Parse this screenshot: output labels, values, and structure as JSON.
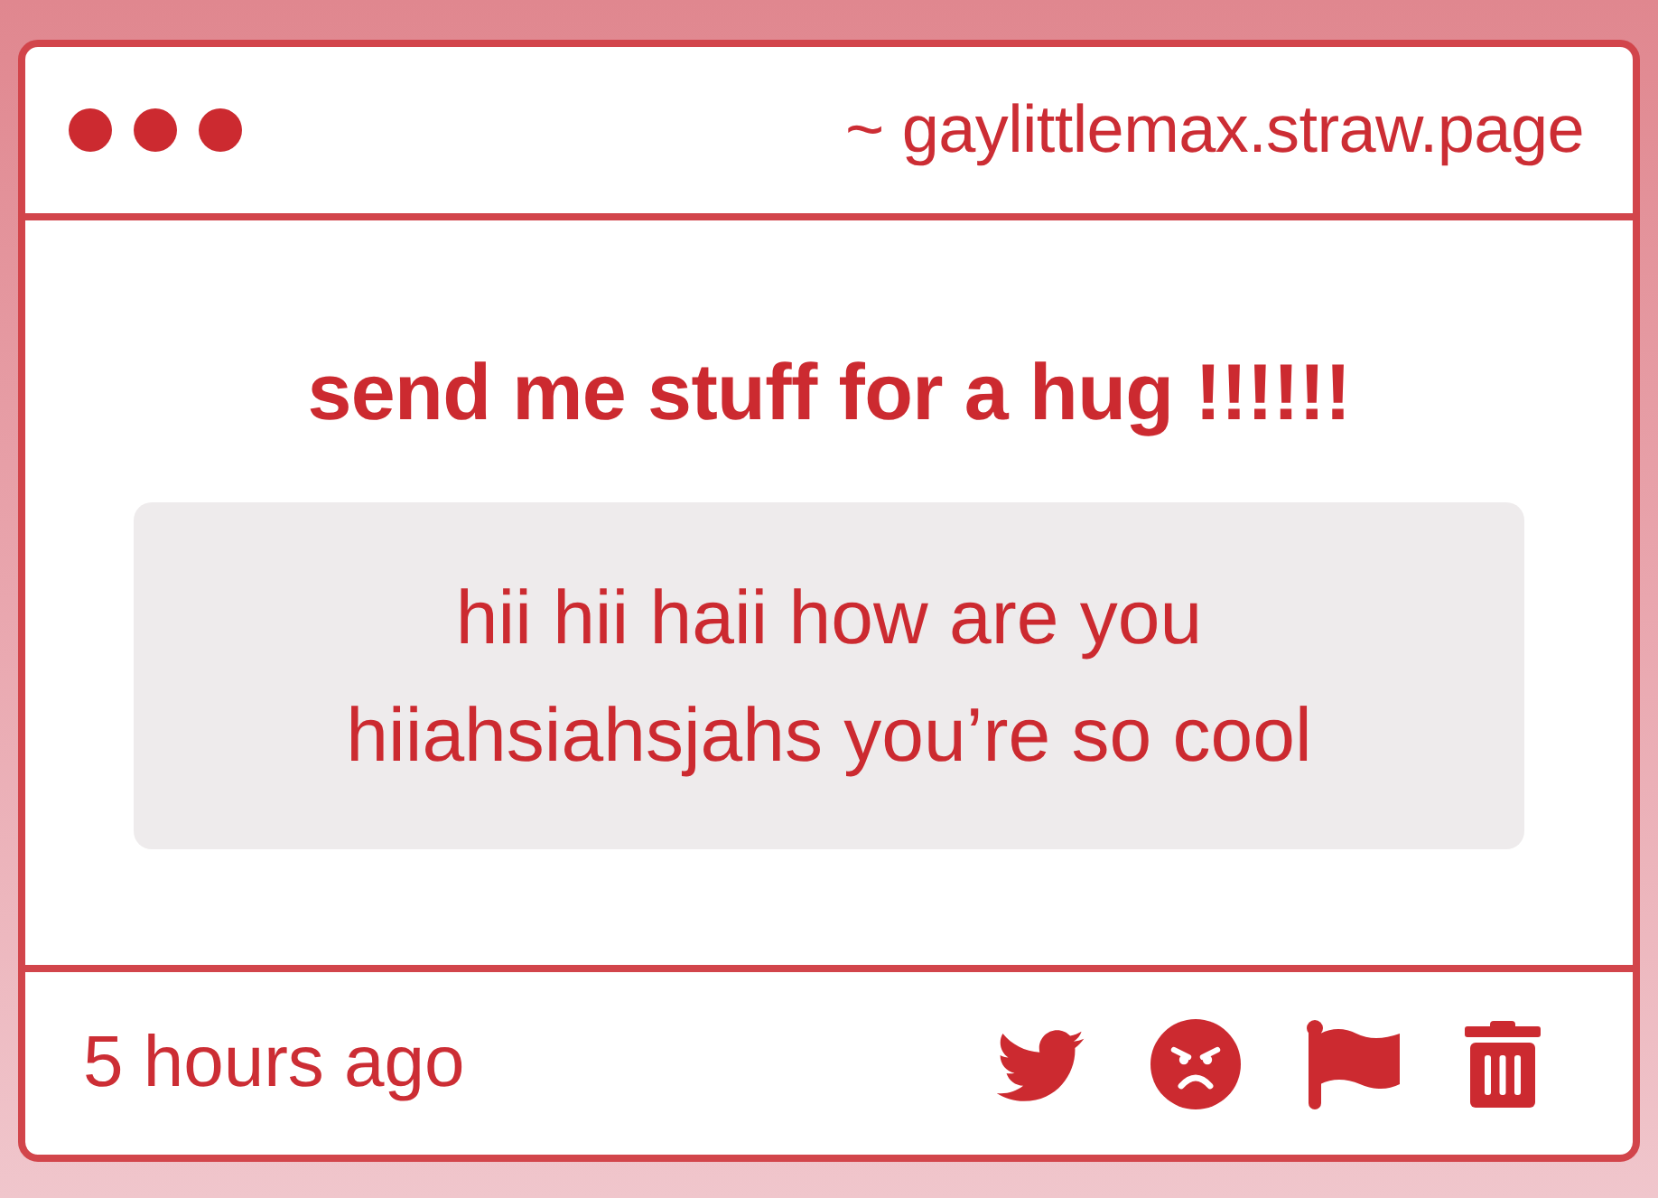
{
  "header": {
    "address": "~ gaylittlemax.straw.page"
  },
  "prompt": {
    "title": "send me stuff for a hug !!!!!!",
    "message": "hii hii haii how are you hiiahsiahsjahs you’re so cool"
  },
  "footer": {
    "time": "5 hours ago"
  }
}
